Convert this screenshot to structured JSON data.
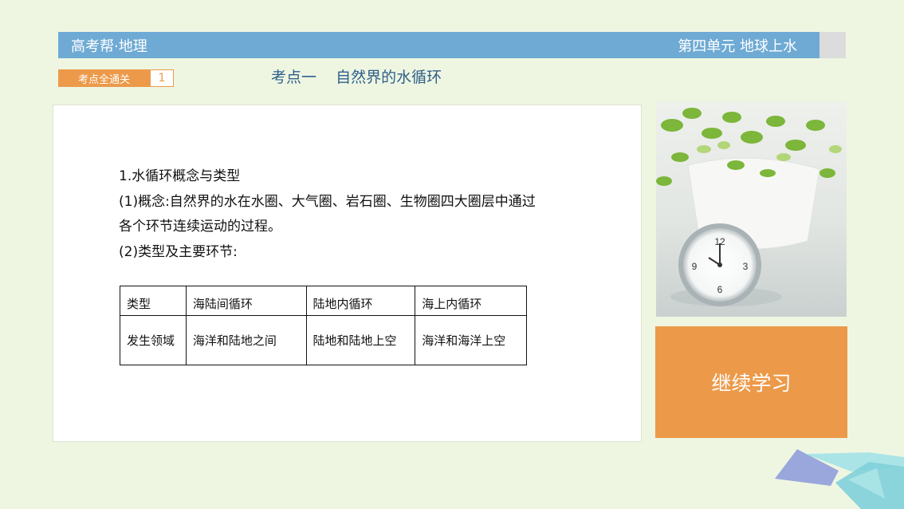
{
  "header": {
    "left_title": "高考帮·地理",
    "right_title": "第四单元 地球上水"
  },
  "badge": {
    "label": "考点全通关",
    "number": "1"
  },
  "section_title": "考点一    自然界的水循环",
  "content": {
    "lines": [
      "1.水循环概念与类型",
      "(1)概念:自然界的水在水圈、大气圈、岩石圈、生物圈四大圈层中通过",
      "各个环节连续运动的过程。",
      "(2)类型及主要环节:"
    ],
    "table": {
      "rows": [
        [
          "类型",
          "海陆间循环",
          "陆地内循环",
          "海上内循环"
        ],
        [
          "发生领域",
          "海洋和陆地之间",
          "陆地和陆地上空",
          "海洋和海洋上空"
        ]
      ]
    }
  },
  "photo": {
    "clock_numbers": [
      "12",
      "3",
      "6",
      "9"
    ]
  },
  "continue_button": {
    "label": "继续学习"
  },
  "colors": {
    "header": "#6eaad4",
    "accent_orange": "#ec9a4a",
    "title_blue": "#2f5f8a",
    "background": "#eef6e2"
  }
}
